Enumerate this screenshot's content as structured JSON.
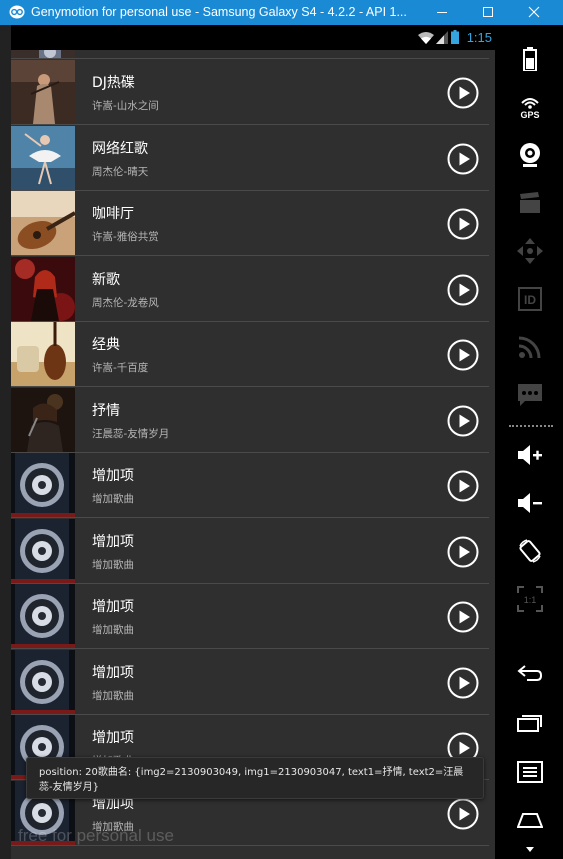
{
  "window": {
    "title": "Genymotion for personal use - Samsung Galaxy S4 - 4.2.2 - API 1..."
  },
  "statusbar": {
    "clock": "1:15"
  },
  "list": {
    "rows": [
      {
        "title": "DJ热碟",
        "subtitle": "许嵩-山水之间",
        "thumb": "violinist"
      },
      {
        "title": "网络红歌",
        "subtitle": "周杰伦-晴天",
        "thumb": "dancer"
      },
      {
        "title": "咖啡厅",
        "subtitle": "许嵩-雅俗共赏",
        "thumb": "guitar"
      },
      {
        "title": "新歌",
        "subtitle": "周杰伦-龙卷风",
        "thumb": "singer-red"
      },
      {
        "title": "经典",
        "subtitle": "许嵩-千百度",
        "thumb": "cello"
      },
      {
        "title": "抒情",
        "subtitle": "汪晨蕊-友情岁月",
        "thumb": "singer-mic"
      },
      {
        "title": "增加项",
        "subtitle": "增加歌曲",
        "thumb": "speaker"
      },
      {
        "title": "增加项",
        "subtitle": "增加歌曲",
        "thumb": "speaker"
      },
      {
        "title": "增加项",
        "subtitle": "增加歌曲",
        "thumb": "speaker"
      },
      {
        "title": "增加项",
        "subtitle": "增加歌曲",
        "thumb": "speaker"
      },
      {
        "title": "增加项",
        "subtitle": "增加歌曲",
        "thumb": "speaker"
      },
      {
        "title": "增加项",
        "subtitle": "增加歌曲",
        "thumb": "speaker"
      }
    ]
  },
  "toast": {
    "text": "position: 20歌曲名: {img2=2130903049, img1=2130903047, text1=抒情, text2=汪晨蕊-友情岁月}"
  },
  "watermark": {
    "text": "free for personal use"
  },
  "sidebar": {
    "items": [
      "battery-icon",
      "gps-icon",
      "webcam-icon",
      "video-capture-icon",
      "dpad-icon",
      "id-icon",
      "rss-icon",
      "sms-icon",
      "volume-up-icon",
      "volume-down-icon",
      "rotate-icon",
      "scale-icon",
      "back-icon",
      "recent-apps-icon",
      "menu-icon",
      "home-icon"
    ],
    "gps_label": "GPS",
    "id_label": "ID",
    "scale_label": "1:1"
  },
  "colors": {
    "titlebar": "#1a8ad4",
    "list_bg": "#2f2f2f",
    "clock": "#36a5de"
  }
}
